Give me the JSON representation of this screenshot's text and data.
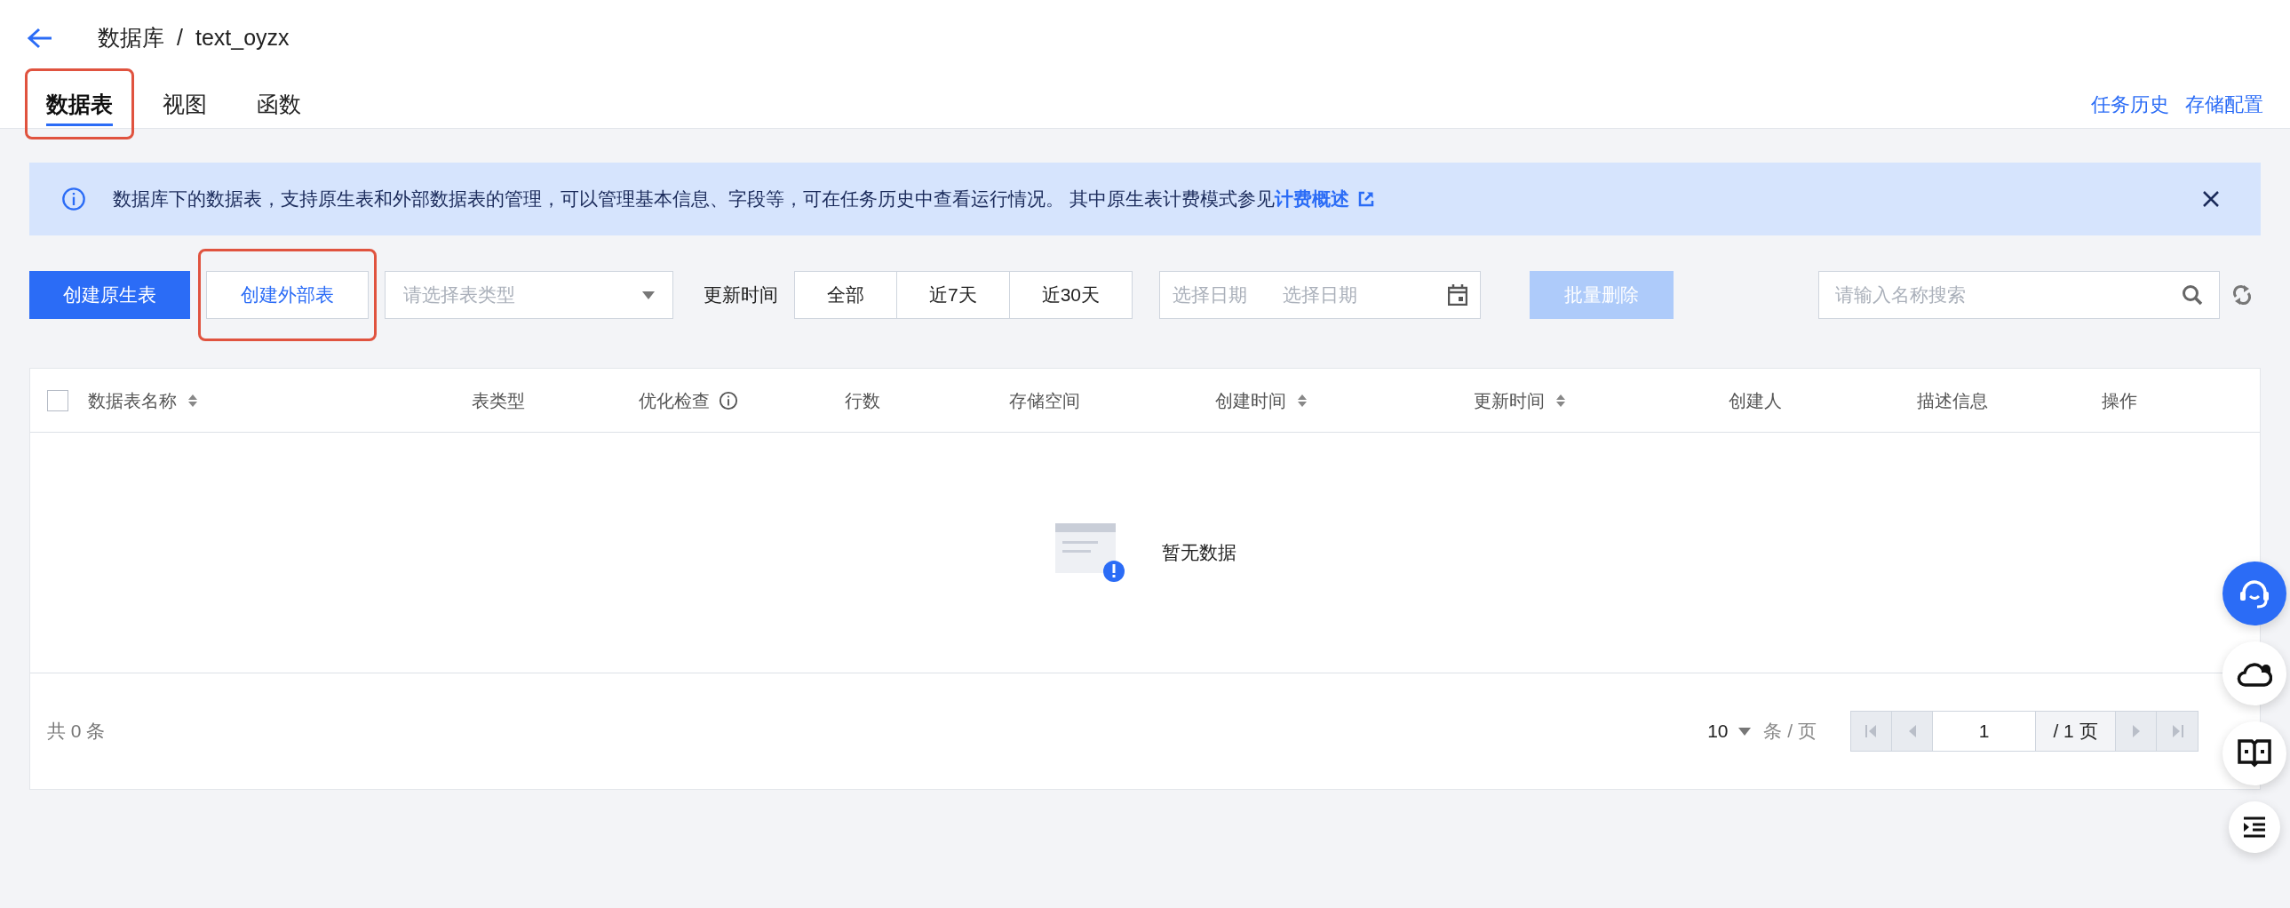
{
  "header": {
    "breadcrumb": [
      "数据库",
      "text_oyzx"
    ],
    "separator": "/"
  },
  "tabs": [
    {
      "label": "数据表",
      "selected": true,
      "highlighted": true
    },
    {
      "label": "视图",
      "selected": false,
      "highlighted": false
    },
    {
      "label": "函数",
      "selected": false,
      "highlighted": false
    }
  ],
  "header_links": [
    "任务历史",
    "存储配置"
  ],
  "notice": {
    "text": "数据库下的数据表，支持原生表和外部数据表的管理，可以管理基本信息、字段等，可在任务历史中查看运行情况。 其中原生表计费模式参见",
    "link": "计费概述"
  },
  "toolbar": {
    "buttons": [
      {
        "label": "创建原生表",
        "kind": "primary",
        "highlighted": false
      },
      {
        "label": "创建外部表",
        "kind": "secondary",
        "highlighted": true
      }
    ],
    "type_select": {
      "placeholder": "请选择表类型"
    },
    "time_filter": {
      "label": "更新时间",
      "options": [
        {
          "label": "全部",
          "selected": false
        },
        {
          "label": "近7天",
          "selected": false
        },
        {
          "label": "近30天",
          "selected": false
        }
      ]
    },
    "date_range": {
      "start_placeholder": "选择日期",
      "end_placeholder": "选择日期"
    },
    "batch_delete": {
      "label": "批量删除",
      "disabled": true
    },
    "search": {
      "placeholder": "请输入名称搜索"
    }
  },
  "table": {
    "select_all_checked": false,
    "columns": [
      {
        "label": "数据表名称",
        "sortable": true,
        "info": false
      },
      {
        "label": "表类型",
        "sortable": false,
        "info": false
      },
      {
        "label": "优化检查",
        "sortable": false,
        "info": true
      },
      {
        "label": "行数",
        "sortable": false,
        "info": false
      },
      {
        "label": "存储空间",
        "sortable": false,
        "info": false
      },
      {
        "label": "创建时间",
        "sortable": true,
        "info": false
      },
      {
        "label": "更新时间",
        "sortable": true,
        "info": false
      },
      {
        "label": "创建人",
        "sortable": false,
        "info": false
      },
      {
        "label": "描述信息",
        "sortable": false,
        "info": false
      },
      {
        "label": "操作",
        "sortable": false,
        "info": false
      }
    ],
    "empty_text": "暂无数据"
  },
  "footer": {
    "total_prefix": "共",
    "total": "0",
    "total_suffix": "条",
    "page_size": "10",
    "page_size_unit": "条 / 页",
    "page": "1",
    "page_total": "/ 1 页",
    "nav_disabled": true
  }
}
